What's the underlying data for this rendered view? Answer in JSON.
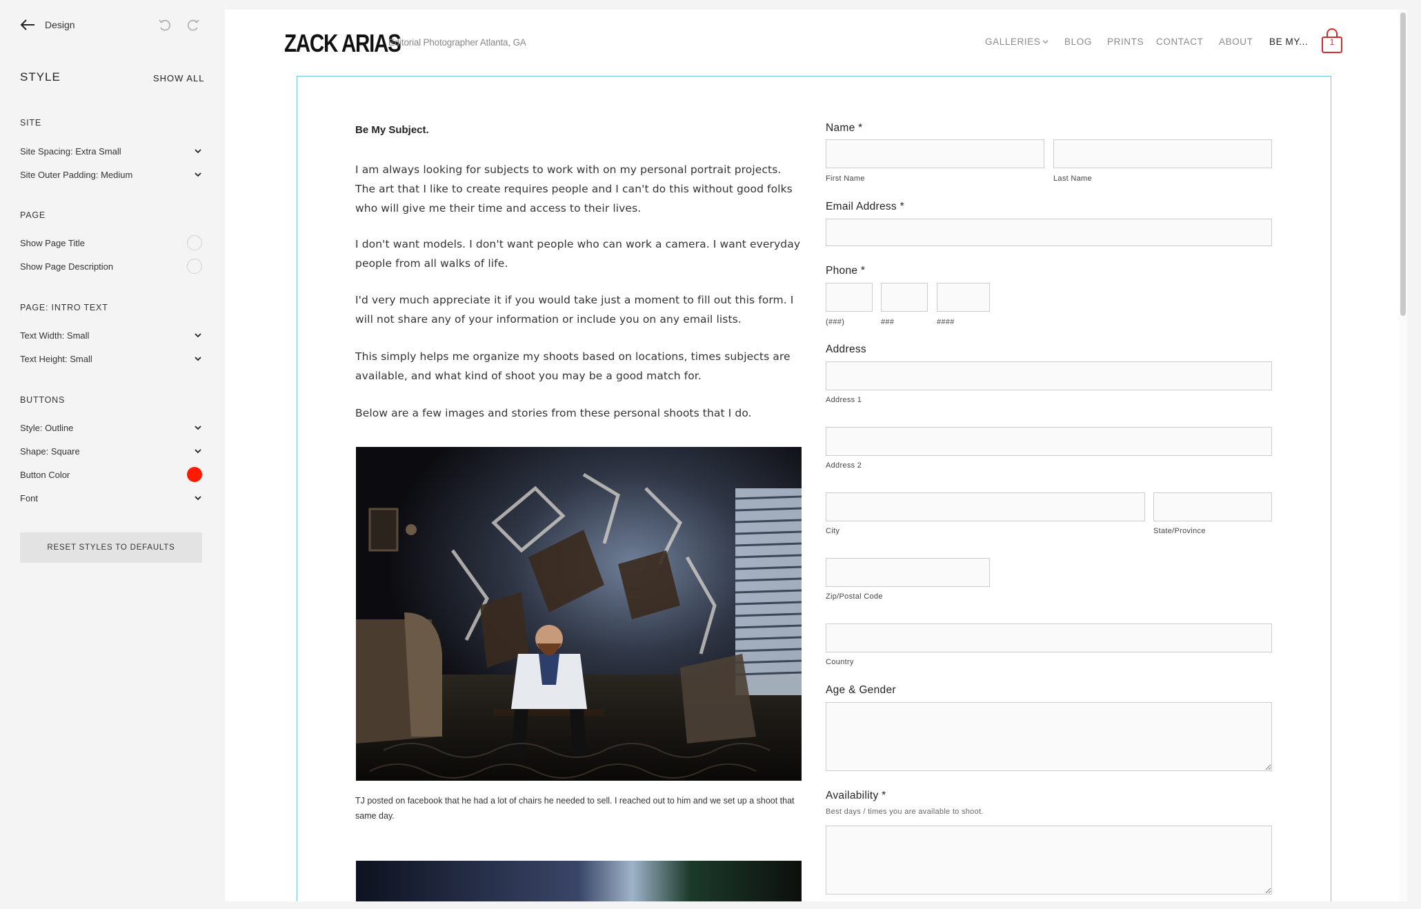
{
  "panel": {
    "back_label": "Design",
    "title": "STYLE",
    "show_all": "SHOW ALL",
    "sections": {
      "site": {
        "heading": "SITE",
        "items": [
          "Site Spacing: Extra Small",
          "Site Outer Padding: Medium"
        ]
      },
      "page": {
        "heading": "PAGE",
        "items": [
          "Show Page Title",
          "Show Page Description"
        ]
      },
      "intro": {
        "heading": "PAGE: INTRO TEXT",
        "items": [
          "Text Width: Small",
          "Text Height: Small"
        ]
      },
      "buttons": {
        "heading": "BUTTONS",
        "items": [
          "Style: Outline",
          "Shape: Square",
          "Button Color",
          "Font"
        ]
      }
    },
    "button_color": "#ff1a00",
    "reset_label": "RESET STYLES TO DEFAULTS"
  },
  "site": {
    "logo": "ZACK ARIAS",
    "tagline": "Editorial Photographer Atlanta, GA",
    "nav": [
      "GALLERIES",
      "BLOG",
      "PRINTS",
      "CONTACT",
      "ABOUT",
      "BE MY..."
    ],
    "cart_count": "1",
    "accent": "#d12b2b",
    "edit_outline": "#6ec7d6"
  },
  "content": {
    "title": "Be My Subject.",
    "paragraphs": [
      "I am always looking for subjects to work with on my personal portrait projects. The art that I like to create requires people and I can't do this without good folks who will give me their time and access to their lives.",
      "I don't want models. I don't want people who can work a camera. I want everyday people from all walks of life.",
      "I'd very much appreciate it if you would take just a moment to fill out this form. I will not share any of your information or include you on any email lists.",
      "This simply helps me organize my shoots based on locations, times subjects are available, and what kind of shoot you may be a good match for.",
      "Below are a few images and stories from these personal shoots that I do."
    ],
    "caption": "TJ posted on facebook that he had a lot of chairs he needed to sell. I reached out to him and we set up a shoot that same day."
  },
  "form": {
    "name_label": "Name *",
    "first_name": "First Name",
    "last_name": "Last Name",
    "email_label": "Email Address *",
    "phone_label": "Phone *",
    "phone_parts": [
      "(###)",
      "###",
      "####"
    ],
    "address_label": "Address",
    "address1": "Address 1",
    "address2": "Address 2",
    "city": "City",
    "state": "State/Province",
    "zip": "Zip/Postal Code",
    "country": "Country",
    "age_label": "Age & Gender",
    "availability_label": "Availability *",
    "availability_desc": "Best days / times  you are available to shoot."
  }
}
